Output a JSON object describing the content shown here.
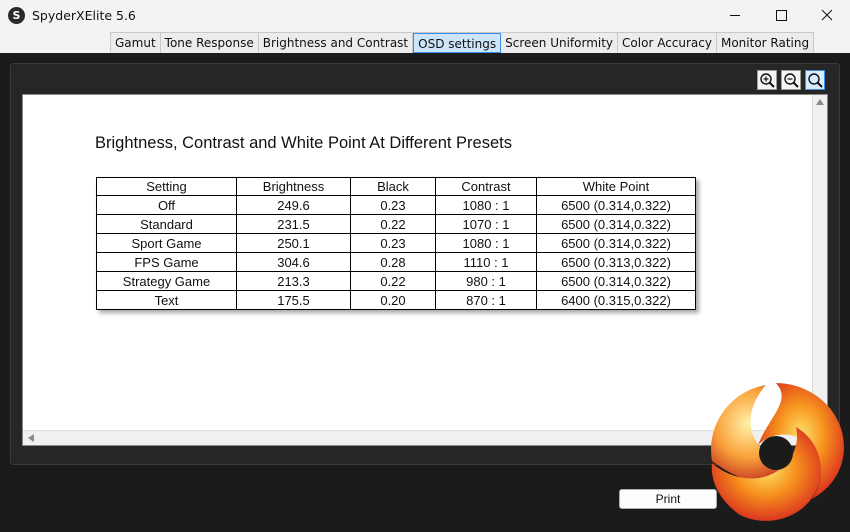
{
  "window": {
    "app_icon_letter": "S",
    "title": "SpyderXElite 5.6"
  },
  "tabs": [
    {
      "label": "Gamut",
      "active": false
    },
    {
      "label": "Tone Response",
      "active": false
    },
    {
      "label": "Brightness and Contrast",
      "active": false
    },
    {
      "label": "OSD settings",
      "active": true
    },
    {
      "label": "Screen Uniformity",
      "active": false
    },
    {
      "label": "Color Accuracy",
      "active": false
    },
    {
      "label": "Monitor Rating",
      "active": false
    }
  ],
  "toolbar": {
    "icons": [
      "zoom-in-icon",
      "zoom-out-icon",
      "zoom-fit-icon"
    ]
  },
  "report": {
    "title": "Brightness, Contrast and White Point At Different Presets",
    "table": {
      "headers": [
        "Setting",
        "Brightness",
        "Black",
        "Contrast",
        "White Point"
      ],
      "rows": [
        [
          "Off",
          "249.6",
          "0.23",
          "1080 : 1",
          "6500 (0.314,0.322)"
        ],
        [
          "Standard",
          "231.5",
          "0.22",
          "1070 : 1",
          "6500 (0.314,0.322)"
        ],
        [
          "Sport Game",
          "250.1",
          "0.23",
          "1080 : 1",
          "6500 (0.314,0.322)"
        ],
        [
          "FPS Game",
          "304.6",
          "0.28",
          "1110 : 1",
          "6500 (0.313,0.322)"
        ],
        [
          "Strategy Game",
          "213.3",
          "0.22",
          "980 : 1",
          "6500 (0.314,0.322)"
        ],
        [
          "Text",
          "175.5",
          "0.20",
          "870 : 1",
          "6400 (0.315,0.322)"
        ]
      ]
    }
  },
  "footer": {
    "print_label": "Print"
  },
  "colors": {
    "active_tab": "#cde5fb",
    "active_tab_border": "#3a8ee6",
    "panel_bg": "#262626",
    "logo_orange": "#f7931e",
    "logo_red": "#d7261e"
  }
}
